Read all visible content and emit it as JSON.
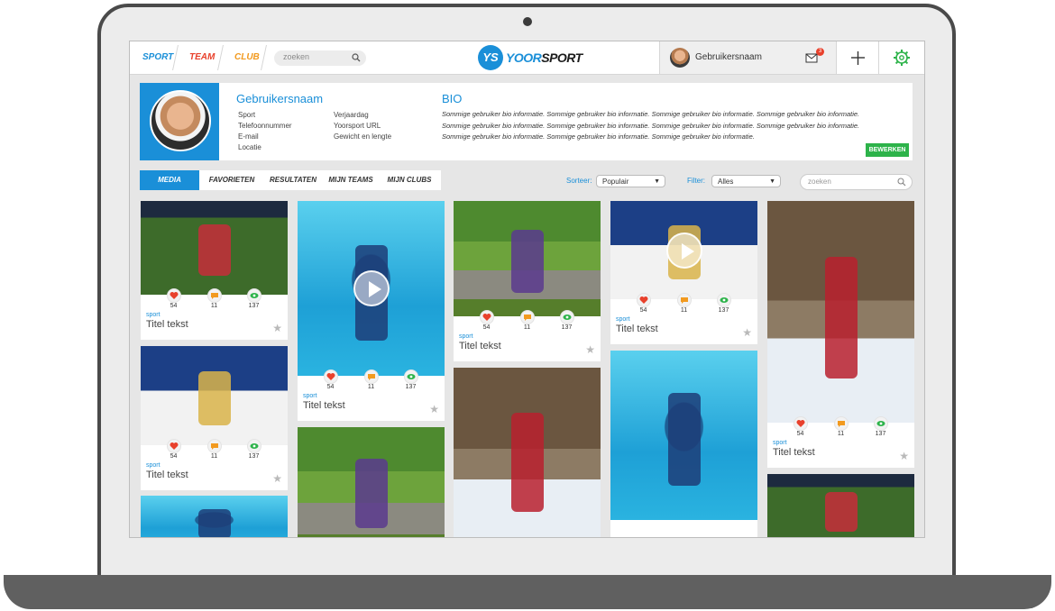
{
  "nav": {
    "tabs": [
      "SPORT",
      "TEAM",
      "CLUB"
    ],
    "search_placeholder": "zoeken"
  },
  "logo": {
    "mark": "YS",
    "text_yoor": "YOOR",
    "text_sport": "SPORT"
  },
  "user": {
    "name": "Gebruikersnaam",
    "mail_count": "3"
  },
  "profile": {
    "name": "Gebruikersnaam",
    "fields_left": [
      "Sport",
      "Telefoonnummer",
      "E-mail",
      "Locatie"
    ],
    "fields_right": [
      "Verjaardag",
      "Yoorsport URL",
      "Gewicht en lengte"
    ],
    "bio_title": "BIO",
    "bio_text": "Sommige gebruiker bio informatie.  Sommige gebruiker bio informatie.  Sommige gebruiker bio informatie.  Sommige gebruiker bio informatie.  Sommige gebruiker bio informatie.  Sommige gebruiker bio informatie.  Sommige gebruiker bio informatie.  Sommige gebruiker bio informatie.  Sommige gebruiker bio informatie.  Sommige gebruiker bio informatie.  Sommige gebruiker bio informatie.",
    "edit_label": "BEWERKEN"
  },
  "tabs": [
    "MEDIA",
    "FAVORIETEN",
    "RESULTATEN",
    "MIJN TEAMS",
    "MIJN CLUBS"
  ],
  "sort": {
    "label": "Sorteer:",
    "value": "Populair"
  },
  "filter": {
    "label": "Filter:",
    "value": "Alles"
  },
  "filter_search_placeholder": "zoeken",
  "card": {
    "likes": "54",
    "comments": "11",
    "views": "137",
    "category": "sport",
    "title": "Titel tekst"
  },
  "colors": {
    "accent": "#1a8fd8",
    "like": "#e8412c",
    "comment": "#f29a1f",
    "view": "#2db34a",
    "edit": "#2db34a"
  }
}
